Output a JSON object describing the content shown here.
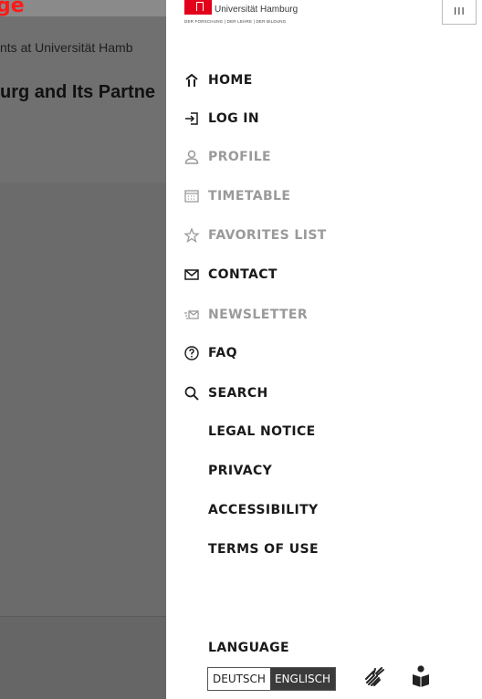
{
  "background_page": {
    "banner_text": "ge",
    "subtitle": "nts at Universität Hamb",
    "title": "urg and Its Partne"
  },
  "header": {
    "logo_name": "Universität Hamburg",
    "logo_tagline": "DER FORSCHUNG | DER LEHRE | DER BILDUNG",
    "close_icon": "III"
  },
  "menu": {
    "items": [
      {
        "label": "HOME",
        "icon": "home-icon",
        "state": "active"
      },
      {
        "label": "LOG IN",
        "icon": "login-icon",
        "state": "active"
      },
      {
        "label": "PROFILE",
        "icon": "user-icon",
        "state": "inactive"
      },
      {
        "label": "TIMETABLE",
        "icon": "calendar-icon",
        "state": "inactive"
      },
      {
        "label": "FAVORITES LIST",
        "icon": "star-icon",
        "state": "inactive"
      },
      {
        "label": "CONTACT",
        "icon": "mail-icon",
        "state": "active"
      },
      {
        "label": "NEWSLETTER",
        "icon": "send-mail-icon",
        "state": "inactive"
      },
      {
        "label": "FAQ",
        "icon": "question-icon",
        "state": "active"
      },
      {
        "label": "SEARCH",
        "icon": "search-icon",
        "state": "active"
      }
    ],
    "secondary": [
      {
        "label": "LEGAL NOTICE"
      },
      {
        "label": "PRIVACY"
      },
      {
        "label": "ACCESSIBILITY"
      },
      {
        "label": "TERMS OF USE"
      }
    ]
  },
  "language": {
    "title": "LANGUAGE",
    "options": [
      "DEUTSCH",
      "ENGLISCH"
    ],
    "selected": "ENGLISCH"
  },
  "colors": {
    "brand_red": "#e2001a",
    "active_text": "#1a1a1a",
    "inactive_text": "#9a9a9a",
    "selected_lang_bg": "#3b3b3b"
  }
}
